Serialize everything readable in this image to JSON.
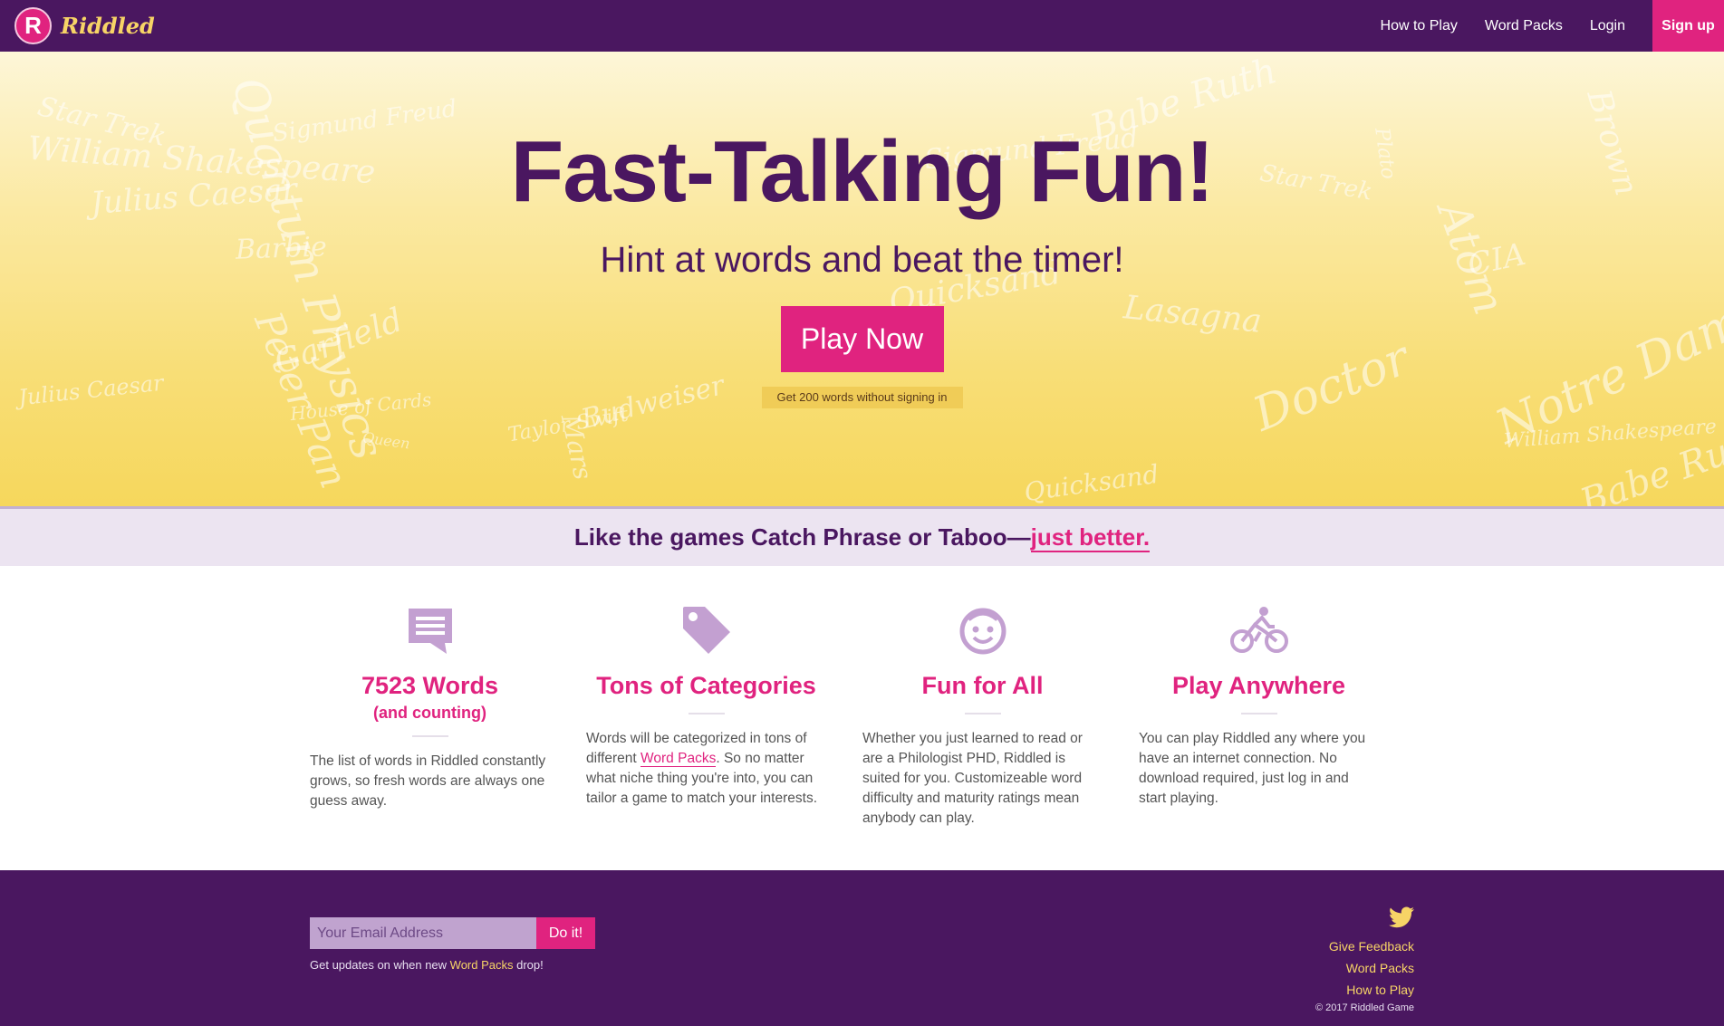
{
  "brand": {
    "logo_letter": "R",
    "name": "Riddled"
  },
  "nav": {
    "links": [
      "How to Play",
      "Word Packs",
      "Login"
    ],
    "signup": "Sign up"
  },
  "hero": {
    "title": "Fast-Talking Fun!",
    "subtitle": "Hint at words and beat the timer!",
    "play_button": "Play Now",
    "play_note": "Get 200 words without signing in",
    "background_words": [
      "Sigmund Freud",
      "Star Trek",
      "William Shakespeare",
      "Julius Caesar",
      "Quicksand",
      "Babe Ruth",
      "Barbie",
      "CIA",
      "Lasagna",
      "Garfield",
      "Queen",
      "House of Cards",
      "Doctor",
      "Notre Dame",
      "Budweiser",
      "Taylor Swift",
      "Plato",
      "Quantum Physics",
      "Atom",
      "Brown",
      "Mars",
      "Peter Pan"
    ]
  },
  "tagline": {
    "text": "Like the games Catch Phrase or Taboo—",
    "link": "just better."
  },
  "features": [
    {
      "icon": "comment-icon",
      "title": "7523 Words",
      "subtitle": "(and counting)",
      "desc": "The list of words in Riddled constantly grows, so fresh words are always one guess away."
    },
    {
      "icon": "tag-icon",
      "title": "Tons of Categories",
      "desc_before": "Words will be categorized in tons of different ",
      "desc_link": "Word Packs",
      "desc_after": ". So no matter what niche thing you're into, you can tailor a game to match your interests."
    },
    {
      "icon": "smiley-icon",
      "title": "Fun for All",
      "desc": "Whether you just learned to read or are a Philologist PHD, Riddled is suited for you. Customizeable word difficulty and maturity ratings mean anybody can play."
    },
    {
      "icon": "bicycle-icon",
      "title": "Play Anywhere",
      "desc": "You can play Riddled any where you have an internet connection. No download required, just log in and start playing."
    }
  ],
  "footer": {
    "email_placeholder": "Your Email Address",
    "submit": "Do it!",
    "note_before": "Get updates on when new ",
    "note_link": "Word Packs",
    "note_after": " drop!",
    "links": [
      "Give Feedback",
      "Word Packs",
      "How to Play"
    ],
    "copyright": "© 2017 Riddled Game"
  },
  "colors": {
    "purple": "#4a1760",
    "pink": "#e0237f",
    "yellow": "#f7d466",
    "icon_lavender": "#c3a0d1"
  }
}
